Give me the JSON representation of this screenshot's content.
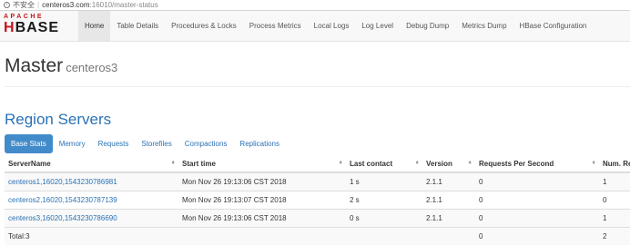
{
  "browser": {
    "security_label": "不安全",
    "url_host": "centeros3.com",
    "url_path": ":16010/master-status"
  },
  "logo": {
    "top_text": "APACHE",
    "main_text_a": "H",
    "main_text_b": "BASE"
  },
  "nav": {
    "items": [
      {
        "label": "Home",
        "active": true
      },
      {
        "label": "Table Details"
      },
      {
        "label": "Procedures & Locks"
      },
      {
        "label": "Process Metrics"
      },
      {
        "label": "Local Logs"
      },
      {
        "label": "Log Level"
      },
      {
        "label": "Debug Dump"
      },
      {
        "label": "Metrics Dump"
      },
      {
        "label": "HBase Configuration"
      }
    ]
  },
  "page": {
    "title": "Master",
    "subtitle": "centeros3"
  },
  "region_servers": {
    "title": "Region Servers",
    "tabs": [
      "Base Stats",
      "Memory",
      "Requests",
      "Storefiles",
      "Compactions",
      "Replications"
    ],
    "columns": [
      "ServerName",
      "Start time",
      "Last contact",
      "Version",
      "Requests Per Second",
      "Num. Re"
    ],
    "rows": [
      [
        "centeros1,16020,1543230786981",
        "Mon Nov 26 19:13:06 CST 2018",
        "1 s",
        "2.1.1",
        "0",
        "1"
      ],
      [
        "centeros2,16020,1543230787139",
        "Mon Nov 26 19:13:07 CST 2018",
        "2 s",
        "2.1.1",
        "0",
        "0"
      ],
      [
        "centeros3,16020,1543230786690",
        "Mon Nov 26 19:13:06 CST 2018",
        "0 s",
        "2.1.1",
        "0",
        "1"
      ]
    ],
    "total_row": [
      "Total:3",
      "",
      "",
      "",
      "0",
      "2"
    ]
  },
  "colors": {
    "link": "#2a72b5",
    "active_tab": "#428bca",
    "logo_red": "#c7131b"
  }
}
